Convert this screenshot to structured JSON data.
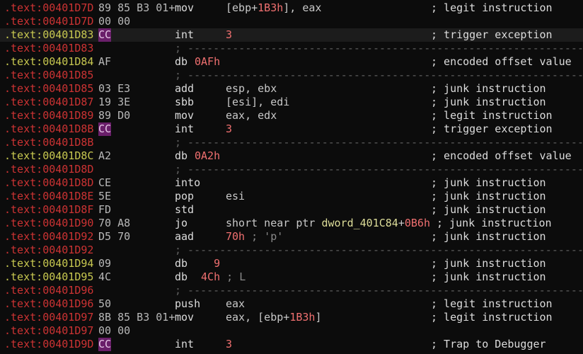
{
  "colors": {
    "background": "#0c0c0c",
    "address_code": "#cc3333",
    "address_data": "#c8c850",
    "cc_highlight": "#6a1f6a",
    "numeric": "#f07070",
    "symbol": "#dddd99",
    "separator": "#5e5e5e"
  },
  "rows": [
    {
      "section": ".text:",
      "addr": "00401D7D",
      "color": "code",
      "bytes": "89 85 B3 01+",
      "mnem": "mov",
      "ops": [
        {
          "t": "[ebp+"
        },
        {
          "t": "1B3h",
          "c": "num"
        },
        {
          "t": "], eax"
        }
      ],
      "comment": "; legit instruction"
    },
    {
      "section": ".text:",
      "addr": "00401D7D",
      "color": "code",
      "bytes": "00 00",
      "mnem": "",
      "ops": [],
      "comment": ""
    },
    {
      "section": ".text:",
      "addr": "00401D83",
      "color": "data",
      "bytes": "CC",
      "cc": true,
      "cursor": true,
      "mnem": "int",
      "ops": [
        {
          "t": "3",
          "c": "num"
        }
      ],
      "comment": "; trigger exception"
    },
    {
      "section": ".text:",
      "addr": "00401D83",
      "color": "code",
      "bytes": "",
      "mnem": "",
      "sep": true,
      "ops": [],
      "comment": ""
    },
    {
      "section": ".text:",
      "addr": "00401D84",
      "color": "data",
      "bytes": "AF",
      "mnem": "db",
      "ops": [
        {
          "t": "0AFh",
          "c": "num"
        }
      ],
      "short": true,
      "comment": "; encoded offset value"
    },
    {
      "section": ".text:",
      "addr": "00401D85",
      "color": "code",
      "bytes": "",
      "mnem": "",
      "sep": true,
      "ops": [],
      "comment": ""
    },
    {
      "section": ".text:",
      "addr": "00401D85",
      "color": "code",
      "bytes": "03 E3",
      "mnem": "add",
      "ops": [
        {
          "t": "esp, ebx"
        }
      ],
      "comment": "; junk instruction"
    },
    {
      "section": ".text:",
      "addr": "00401D87",
      "color": "code",
      "bytes": "19 3E",
      "mnem": "sbb",
      "ops": [
        {
          "t": "[esi], edi"
        }
      ],
      "comment": "; junk instruction"
    },
    {
      "section": ".text:",
      "addr": "00401D89",
      "color": "code",
      "bytes": "89 D0",
      "mnem": "mov",
      "ops": [
        {
          "t": "eax, edx"
        }
      ],
      "comment": "; legit instruction"
    },
    {
      "section": ".text:",
      "addr": "00401D8B",
      "color": "code",
      "bytes": "CC",
      "cc": true,
      "mnem": "int",
      "ops": [
        {
          "t": "3",
          "c": "num"
        }
      ],
      "comment": "; trigger exception"
    },
    {
      "section": ".text:",
      "addr": "00401D8B",
      "color": "code",
      "bytes": "",
      "mnem": "",
      "sep": true,
      "ops": [],
      "comment": ""
    },
    {
      "section": ".text:",
      "addr": "00401D8C",
      "color": "data",
      "bytes": "A2",
      "mnem": "db",
      "ops": [
        {
          "t": "0A2h",
          "c": "num"
        }
      ],
      "short": true,
      "comment": "; encoded offset value"
    },
    {
      "section": ".text:",
      "addr": "00401D8D",
      "color": "code",
      "bytes": "",
      "mnem": "",
      "sep": true,
      "ops": [],
      "comment": ""
    },
    {
      "section": ".text:",
      "addr": "00401D8D",
      "color": "code",
      "bytes": "CE",
      "mnem": "into",
      "ops": [],
      "comment": "; junk instruction"
    },
    {
      "section": ".text:",
      "addr": "00401D8E",
      "color": "code",
      "bytes": "5E",
      "mnem": "pop",
      "ops": [
        {
          "t": "esi"
        }
      ],
      "comment": "; junk instruction"
    },
    {
      "section": ".text:",
      "addr": "00401D8F",
      "color": "code",
      "bytes": "FD",
      "mnem": "std",
      "ops": [],
      "comment": "; junk instruction"
    },
    {
      "section": ".text:",
      "addr": "00401D90",
      "color": "code",
      "bytes": "70 A8",
      "mnem": "jo",
      "ops": [
        {
          "t": "short near ptr "
        },
        {
          "t": "dword_401C84",
          "c": "sym"
        },
        {
          "t": "+"
        },
        {
          "t": "0B6h",
          "c": "num"
        }
      ],
      "comment": " ; junk instruction",
      "cmtInline": true
    },
    {
      "section": ".text:",
      "addr": "00401D92",
      "color": "code",
      "bytes": "D5 70",
      "mnem": "aad",
      "ops": [
        {
          "t": "70h",
          "c": "num"
        },
        {
          "t": " ; 'p'",
          "c": "cmtinline"
        }
      ],
      "comment": "; junk instruction"
    },
    {
      "section": ".text:",
      "addr": "00401D92",
      "color": "code",
      "bytes": "",
      "mnem": "",
      "sep": true,
      "ops": [],
      "comment": ""
    },
    {
      "section": ".text:",
      "addr": "00401D94",
      "color": "data",
      "bytes": "09",
      "mnem": "db",
      "ops": [
        {
          "t": "   9",
          "c": "num"
        }
      ],
      "short": true,
      "comment": "; junk instruction"
    },
    {
      "section": ".text:",
      "addr": "00401D95",
      "color": "data",
      "bytes": "4C",
      "mnem": "db",
      "ops": [
        {
          "t": " 4Ch",
          "c": "num"
        },
        {
          "t": " ; L",
          "c": "cmtinline"
        }
      ],
      "short": true,
      "comment": "; junk instruction"
    },
    {
      "section": ".text:",
      "addr": "00401D96",
      "color": "code",
      "bytes": "",
      "mnem": "",
      "sep": true,
      "ops": [],
      "comment": ""
    },
    {
      "section": ".text:",
      "addr": "00401D96",
      "color": "code",
      "bytes": "50",
      "mnem": "push",
      "ops": [
        {
          "t": "eax"
        }
      ],
      "comment": "; legit instruction"
    },
    {
      "section": ".text:",
      "addr": "00401D97",
      "color": "code",
      "bytes": "8B 85 B3 01+",
      "mnem": "mov",
      "ops": [
        {
          "t": "eax, [ebp+"
        },
        {
          "t": "1B3h",
          "c": "num"
        },
        {
          "t": "]"
        }
      ],
      "comment": "; legit instruction"
    },
    {
      "section": ".text:",
      "addr": "00401D97",
      "color": "code",
      "bytes": "00 00",
      "mnem": "",
      "ops": [],
      "comment": ""
    },
    {
      "section": ".text:",
      "addr": "00401D9D",
      "color": "code",
      "bytes": "CC",
      "cc": true,
      "mnem": "int",
      "ops": [
        {
          "t": "3",
          "c": "num"
        }
      ],
      "comment": "; Trap to Debugger"
    }
  ]
}
